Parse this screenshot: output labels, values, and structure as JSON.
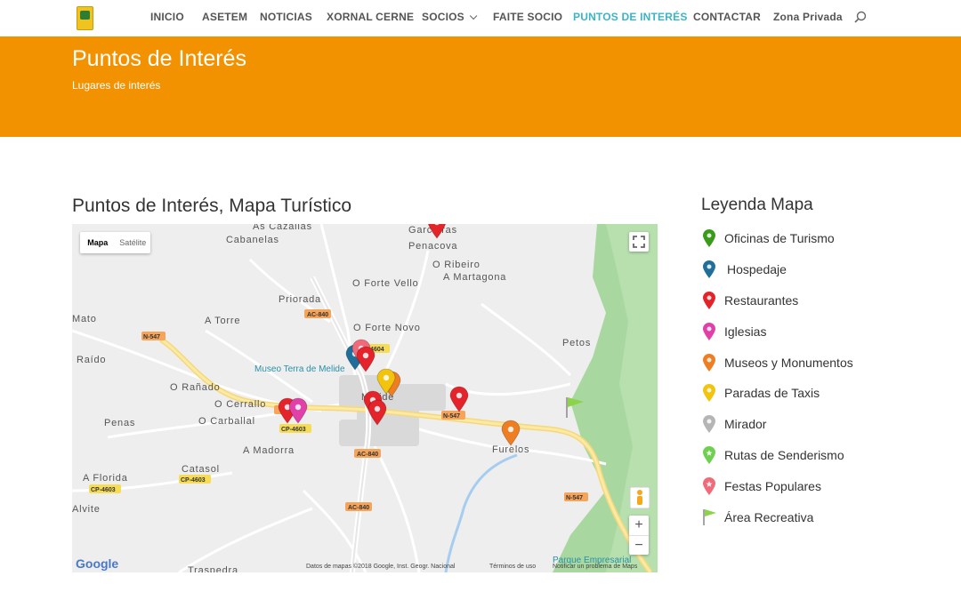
{
  "nav": {
    "items": [
      "INICIO",
      "ASETEM",
      "NOTICIAS",
      "XORNAL CERNE",
      "SOCIOS",
      "FAITE SOCIO",
      "PUNTOS DE INTERÉS",
      "CONTACTAR",
      "Zona Privada"
    ],
    "active": "PUNTOS DE INTERÉS"
  },
  "banner": {
    "title": "Puntos de Interés",
    "subtitle": "Lugares de interés"
  },
  "map": {
    "title": "Puntos de Interés, Mapa Turístico",
    "type_buttons": [
      "Mapa",
      "Satélite"
    ],
    "selected_type": "Mapa",
    "places": [
      "As Cazallas",
      "Cabanelas",
      "Garceiras",
      "Penacova",
      "O Ribeiro",
      "A Martagona",
      "O Forte Vello",
      "Priorada",
      "A Torre",
      "O Forte Novo",
      "Mato",
      "Raído",
      "Petos",
      "Museo Terra de Melide",
      "O Rañado",
      "Melide",
      "O Cerrallo",
      "O Carballal",
      "Penas",
      "Furelos",
      "A Madorra",
      "Catasol",
      "A Florida",
      "Alvite",
      "Traspedra",
      "Parque Empresarial"
    ],
    "roads": [
      "AC-840",
      "N-547",
      "DP-4604",
      "CP-4603",
      "CP-4603",
      "AC-840",
      "AC-840",
      "N-547",
      "N-547",
      "CP-4603",
      "N-547"
    ],
    "credits": [
      "Datos de mapas ©2018 Google, Inst. Geogr. Nacional",
      "Términos de uso",
      "Notificar un problema de Maps"
    ],
    "google_label": "Google",
    "zoom_in": "+",
    "zoom_out": "−"
  },
  "legend": {
    "title": "Leyenda Mapa",
    "items": [
      {
        "label": "Oficinas de Turismo",
        "color": "#3a9a1a"
      },
      {
        "label": "Hospedaje",
        "color": "#1f6f9a"
      },
      {
        "label": "Restaurantes",
        "color": "#e5232a"
      },
      {
        "label": "Iglesias",
        "color": "#e040a8"
      },
      {
        "label": "Museos y Monumentos",
        "color": "#ef7d22"
      },
      {
        "label": "Paradas de Taxis",
        "color": "#f2c40d"
      },
      {
        "label": "Mirador",
        "color": "#b5b5b5"
      },
      {
        "label": "Rutas de Senderismo",
        "color": "#6fcf4f"
      },
      {
        "label": "Festas Populares",
        "color": "#f06a7a"
      },
      {
        "label": "Área Recreativa",
        "color": "#8bd44a"
      }
    ]
  },
  "colors": {
    "banner": "#f39200",
    "active_nav": "#3bb4c6"
  }
}
